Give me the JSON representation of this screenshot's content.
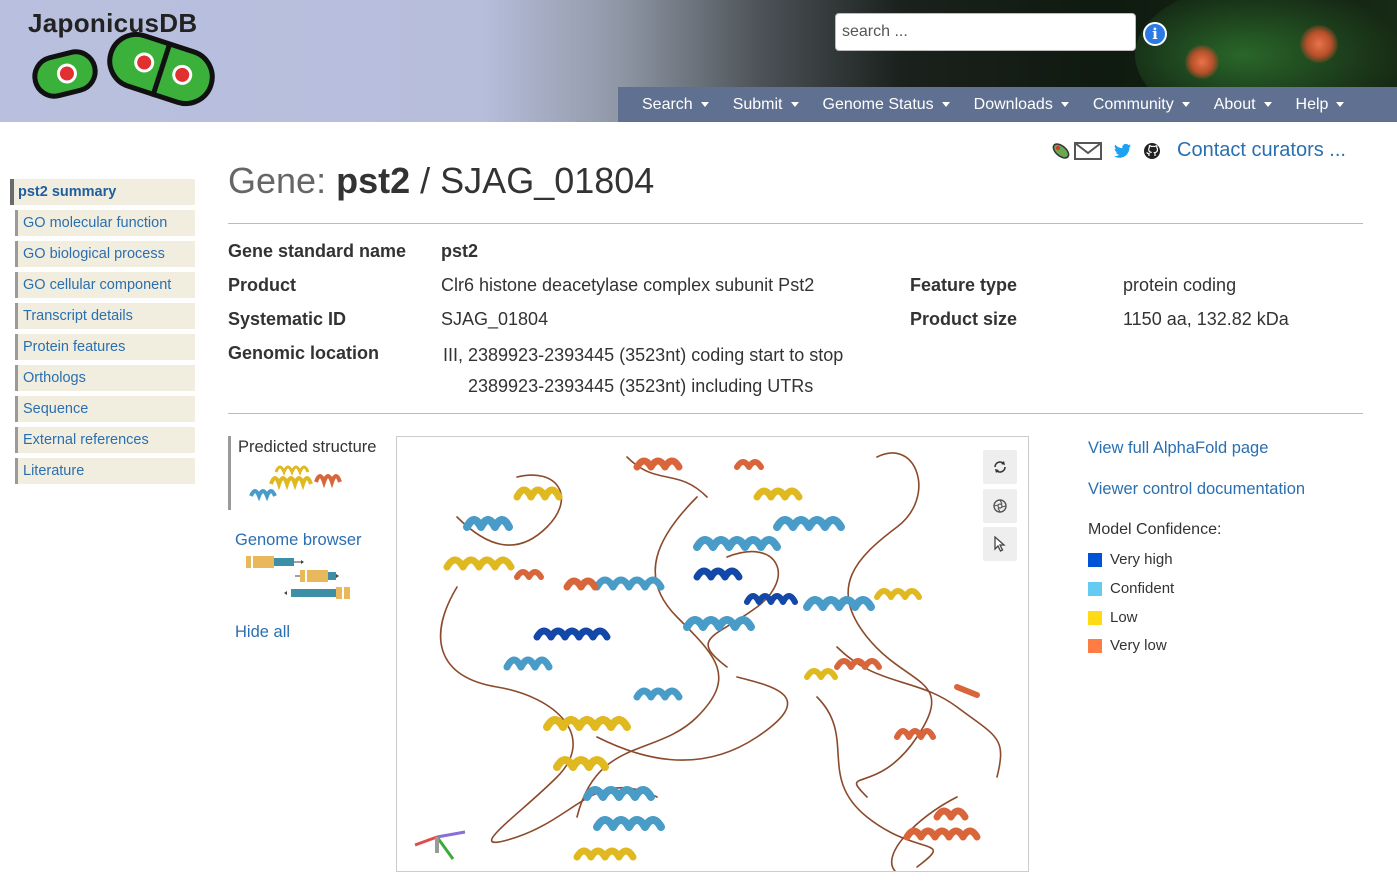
{
  "header": {
    "logo_text": "JaponicusDB",
    "search_placeholder": "search ...",
    "nav": [
      {
        "label": "Search"
      },
      {
        "label": "Submit"
      },
      {
        "label": "Genome Status"
      },
      {
        "label": "Downloads"
      },
      {
        "label": "Community"
      },
      {
        "label": "About"
      },
      {
        "label": "Help"
      }
    ]
  },
  "contact": {
    "label": "Contact curators ..."
  },
  "sidebar": {
    "items": [
      {
        "label": "pst2 summary"
      },
      {
        "label": "GO molecular function"
      },
      {
        "label": "GO biological process"
      },
      {
        "label": "GO cellular component"
      },
      {
        "label": "Transcript details"
      },
      {
        "label": "Protein features"
      },
      {
        "label": "Orthologs"
      },
      {
        "label": "Sequence"
      },
      {
        "label": "External references"
      },
      {
        "label": "Literature"
      }
    ]
  },
  "title": {
    "prefix": "Gene:",
    "gene_name": "pst2",
    "separator": "/",
    "systematic_id": "SJAG_01804"
  },
  "details": {
    "gene_standard_name": {
      "label": "Gene standard name",
      "value": "pst2"
    },
    "product": {
      "label": "Product",
      "value": "Clr6 histone deacetylase complex subunit Pst2"
    },
    "feature_type": {
      "label": "Feature type",
      "value": "protein coding"
    },
    "systematic_id": {
      "label": "Systematic ID",
      "value": "SJAG_01804"
    },
    "product_size": {
      "label": "Product size",
      "value": "1150 aa, 132.82 kDa"
    },
    "genomic_location": {
      "label": "Genomic location",
      "line1": "III, 2389923-2393445 (3523nt) coding start to stop",
      "line2": "2389923-2393445 (3523nt) including UTRs"
    }
  },
  "panel": {
    "predicted_structure": "Predicted structure",
    "genome_browser": "Genome browser",
    "hide_all": "Hide all"
  },
  "right_panel": {
    "alphafold_link": "View full AlphaFold page",
    "viewer_docs_link": "Viewer control documentation",
    "confidence_title": "Model Confidence:",
    "legend": [
      {
        "label": "Very high",
        "color": "#0053d6"
      },
      {
        "label": "Confident",
        "color": "#65cbf3"
      },
      {
        "label": "Low",
        "color": "#ffdb13"
      },
      {
        "label": "Very low",
        "color": "#ff7d45"
      }
    ]
  },
  "colors": {
    "link": "#2a6fb0",
    "navbar": "#5f7090",
    "sidebar_bg": "#f2eedf",
    "helix_dark_blue": "#1448a8",
    "helix_light_blue": "#4a9cc8",
    "helix_yellow": "#e0b820",
    "helix_orange": "#d9663a",
    "coil_brown": "#8b4a2b"
  }
}
